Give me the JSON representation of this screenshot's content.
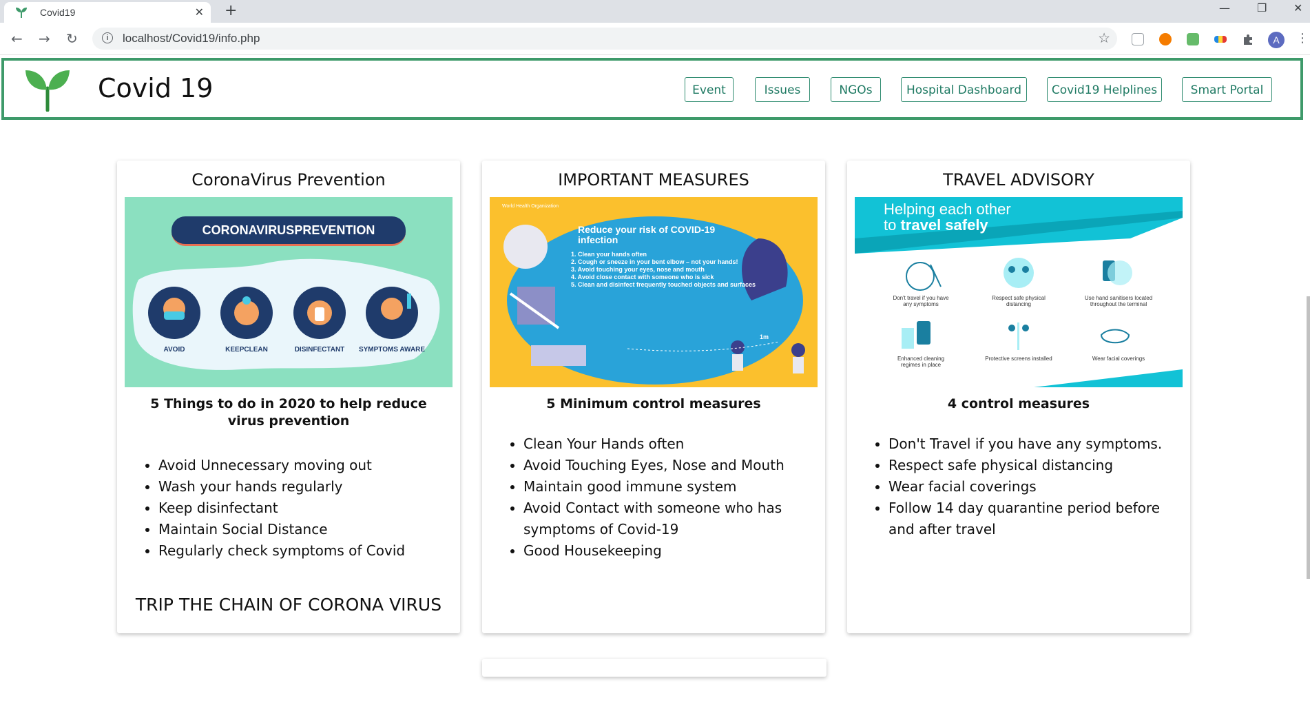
{
  "browser": {
    "tab_title": "Covid19",
    "tab_close": "✕",
    "new_tab": "+",
    "url": "localhost/Covid19/info.php",
    "info_glyph": "i",
    "back": "←",
    "forward": "→",
    "reload": "↻",
    "star": "☆",
    "minimize": "—",
    "maximize": "❐",
    "close": "✕",
    "profile_initial": "A",
    "menu": "⋮"
  },
  "header": {
    "brand": "Covid 19",
    "logo_icon": "sprout-icon",
    "brand_color": "#3e9a6a",
    "nav": [
      {
        "label": "Event"
      },
      {
        "label": "Issues"
      },
      {
        "label": "NGOs"
      },
      {
        "label": "Hospital Dashboard"
      },
      {
        "label": "Covid19 Helplines"
      },
      {
        "label": "Smart Portal"
      }
    ]
  },
  "cards": [
    {
      "title": "CoronaVirus Prevention",
      "image": {
        "banner": "CORONAVIRUSPREVENTION",
        "labels": [
          "AVOID",
          "KEEPCLEAN",
          "DISINFECTANT",
          "SYMPTOMS AWARE"
        ]
      },
      "subtitle": "5 Things to do in 2020 to help reduce virus prevention",
      "items": [
        "Avoid Unnecessary moving out",
        "Wash your hands regularly",
        "Keep disinfectant",
        "Maintain Social Distance",
        "Regularly check symptoms of Covid"
      ],
      "footer": "TRIP THE CHAIN OF CORONA VIRUS"
    },
    {
      "title": "IMPORTANT MEASURES",
      "image": {
        "org": "World Health Organization",
        "heading": "Reduce your risk of COVID-19 infection",
        "points": [
          "1.  Clean your hands often",
          "2.  Cough or sneeze in your bent elbow – not your hands!",
          "3.  Avoid touching your eyes, nose and mouth",
          "4.  Avoid close contact with someone who is sick",
          "5.  Clean and disinfect frequently touched objects and surfaces"
        ],
        "distance": "1m"
      },
      "subtitle": "5 Minimum control measures",
      "items": [
        "Clean Your Hands often",
        "Avoid Touching Eyes, Nose and Mouth",
        "Maintain good immune system",
        "Avoid Contact with someone who has symptoms of Covid-19",
        "Good Housekeeping"
      ]
    },
    {
      "title": "TRAVEL ADVISORY",
      "image": {
        "heading_line1": "Helping each other",
        "heading_line2_prefix": "to ",
        "heading_line2_bold": "travel safely",
        "captions": [
          "Don't travel if you have any symptoms",
          "Respect safe physical distancing",
          "Use hand sanitisers located throughout the terminal",
          "Enhanced cleaning regimes in place",
          "Protective screens installed",
          "Wear facial coverings"
        ]
      },
      "subtitle": "4 control measures",
      "items": [
        "Don't Travel if you have any symptoms.",
        "Respect safe physical distancing",
        "Wear facial coverings",
        "Follow 14 day quarantine period before and after travel"
      ]
    }
  ]
}
